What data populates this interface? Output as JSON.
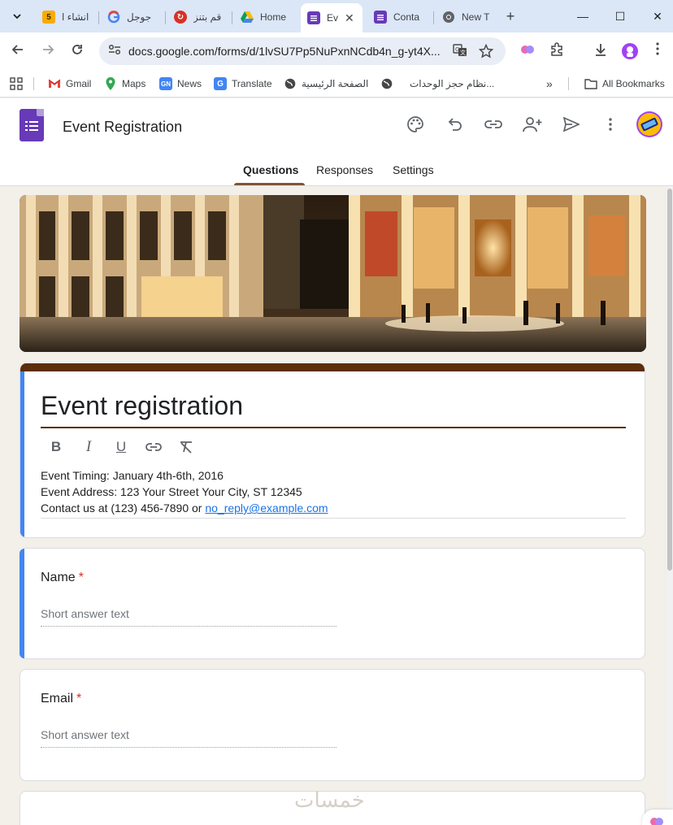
{
  "browser": {
    "tabs": [
      {
        "label": "انشاء ا",
        "favicon": "5",
        "favicon_color": "#f9ab00",
        "rtl": true
      },
      {
        "label": "جوجل",
        "favicon": "G",
        "favicon_color": "#4285f4",
        "rtl": true
      },
      {
        "label": "قم بتنز",
        "favicon": "↻",
        "favicon_color": "#d93025",
        "rtl": true
      },
      {
        "label": "Home",
        "favicon": "drive",
        "favicon_color": "#0f9d58",
        "rtl": false
      },
      {
        "label": "Ev",
        "favicon": "forms",
        "favicon_color": "#673ab7",
        "rtl": false,
        "active": true
      },
      {
        "label": "Conta",
        "favicon": "forms",
        "favicon_color": "#673ab7",
        "rtl": false
      },
      {
        "label": "New T",
        "favicon": "chrome",
        "favicon_color": "#5f6368",
        "rtl": false
      }
    ],
    "url": "docs.google.com/forms/d/1lvSU7Pp5NuPxnNCdb4n_g-yt4X...",
    "bookmarks": [
      {
        "label": "Gmail",
        "icon": "gmail-icon"
      },
      {
        "label": "Maps",
        "icon": "maps-icon"
      },
      {
        "label": "News",
        "icon": "news-icon"
      },
      {
        "label": "Translate",
        "icon": "translate-icon"
      },
      {
        "label": "الصفحة الرئيسية",
        "icon": "globe-icon"
      },
      {
        "label": "نظام حجز الوحدات...",
        "icon": "globe-icon"
      }
    ],
    "all_bookmarks": "All Bookmarks",
    "more_bookmarks": "»"
  },
  "forms": {
    "doc_title": "Event Registration",
    "tabs": [
      "Questions",
      "Responses",
      "Settings"
    ],
    "active_tab": "Questions",
    "accent_color": "#5c2e0a",
    "form_title": "Event registration",
    "description": {
      "line1": "Event Timing: January 4th-6th, 2016",
      "line2": "Event Address: 123 Your Street Your City, ST 12345",
      "line3_prefix": "Contact us at (123) 456-7890 or ",
      "email": "no_reply@example.com"
    },
    "questions": [
      {
        "label": "Name",
        "required_mark": "*",
        "placeholder": "Short answer text"
      },
      {
        "label": "Email",
        "required_mark": "*",
        "placeholder": "Short answer text"
      }
    ]
  },
  "watermark": "خمسات"
}
